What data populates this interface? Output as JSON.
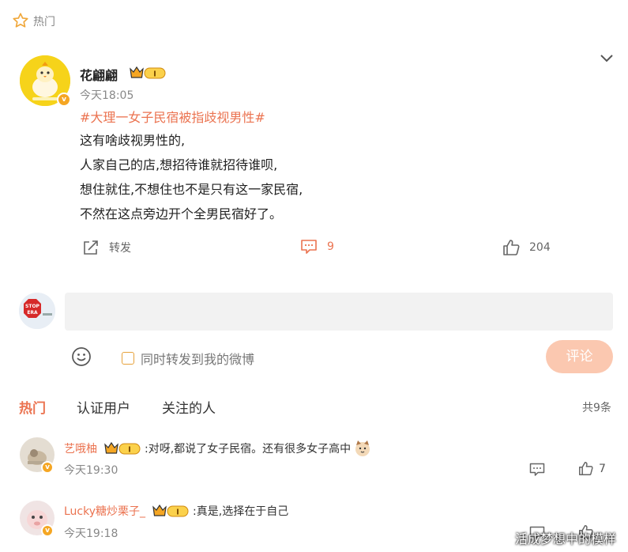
{
  "header": {
    "hot_label": "热门"
  },
  "post": {
    "username": "花翩翩",
    "badge_level": "I",
    "time": "今天18:05",
    "hashtag": "#大理一女子民宿被指歧视男性#",
    "lines": [
      "这有啥歧视男性的,",
      "人家自己的店,想招待谁就招待谁呗,",
      "想住就住,不想住也不是只有这一家民宿,",
      "不然在这点旁边开个全男民宿好了。"
    ],
    "actions": {
      "repost_label": "转发",
      "comment_count": "9",
      "like_count": "204"
    }
  },
  "composer": {
    "avatar_text": "STOP ERA",
    "repost_option": "同时转发到我的微博",
    "submit_label": "评论"
  },
  "tabs": {
    "hot": "热门",
    "verified": "认证用户",
    "following": "关注的人",
    "total": "共9条"
  },
  "comments": [
    {
      "user": "艺哦柚",
      "badge_level": "I",
      "text": ":对呀,都说了女子民宿。还有很多女子高中",
      "time": "今天19:30",
      "likes": "7"
    },
    {
      "user": "Lucky糖炒栗子_",
      "badge_level": "I",
      "text": ":真是,选择在于自己",
      "time": "今天19:18",
      "likes": ""
    }
  ],
  "watermark": "活成梦想中的模样",
  "colors": {
    "accent": "#eb7350",
    "button_disabled": "#fbc8b0",
    "vip_gold": "#f5a623"
  }
}
